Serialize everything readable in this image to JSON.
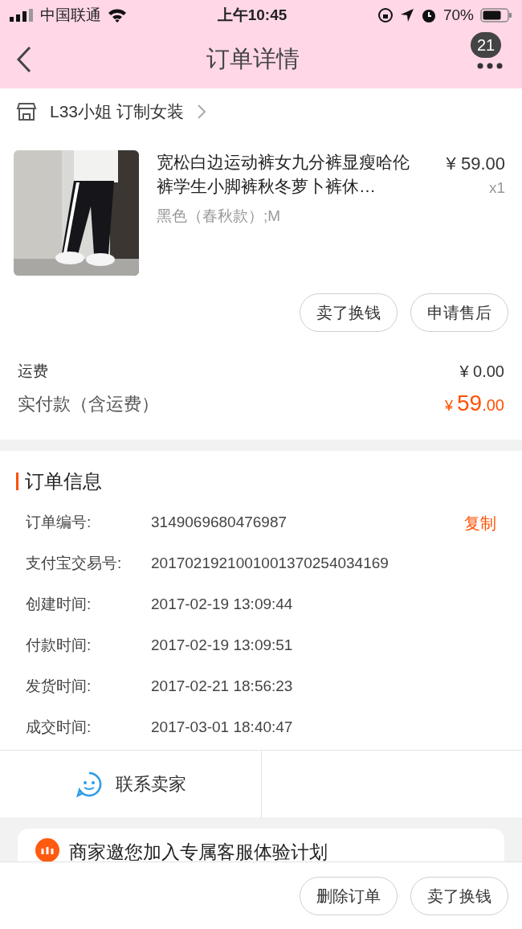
{
  "status_bar": {
    "carrier": "中国联通",
    "time": "上午10:45",
    "battery": "70%"
  },
  "nav": {
    "title": "订单详情",
    "badge": "21"
  },
  "shop": {
    "name": "L33小姐 订制女装"
  },
  "item": {
    "title": "宽松白边运动裤女九分裤显瘦哈伦裤学生小脚裤秋冬萝卜裤休…",
    "price": "¥ 59.00",
    "quantity": "x1",
    "variant": "黑色（春秋款）;M"
  },
  "item_actions": [
    "卖了换钱",
    "申请售后"
  ],
  "totals": {
    "shipping_label": "运费",
    "shipping": "¥ 0.00",
    "paid_label": "实付款（含运费）",
    "paid_currency": "¥",
    "paid_integer": "59",
    "paid_decimal": ".00"
  },
  "order_info": {
    "title": "订单信息",
    "copy": "复制",
    "rows": [
      {
        "label": "订单编号:",
        "value": "3149069680476987"
      },
      {
        "label": "支付宝交易号:",
        "value": "2017021921001001370254034169"
      },
      {
        "label": "创建时间:",
        "value": "2017-02-19 13:09:44"
      },
      {
        "label": "付款时间:",
        "value": "2017-02-19 13:09:51"
      },
      {
        "label": "发货时间:",
        "value": "2017-02-21 18:56:23"
      },
      {
        "label": "成交时间:",
        "value": "2017-03-01 18:40:47"
      }
    ]
  },
  "contact": "联系卖家",
  "promo": "商家邀您加入专属客服体验计划",
  "bottom_actions": [
    "删除订单",
    "卖了换钱"
  ]
}
